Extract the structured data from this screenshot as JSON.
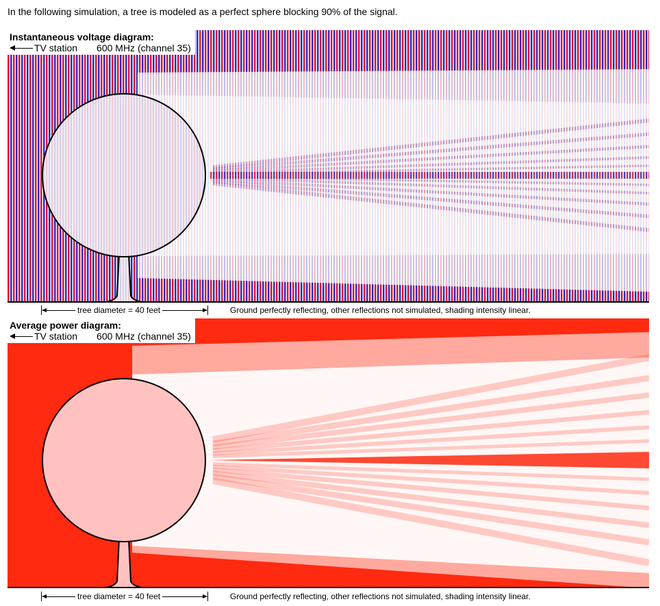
{
  "intro_text": "In the following simulation, a tree is modeled as a perfect sphere blocking 90% of the signal.",
  "diagrams": [
    {
      "title": "Instantaneous voltage diagram:",
      "direction_label": "TV station",
      "frequency_label": "600 MHz (channel 35)",
      "dimension_label": "tree diameter = 40 feet",
      "caption": "Ground perfectly reflecting, other reflections not simulated, shading intensity linear."
    },
    {
      "title": "Average power diagram:",
      "direction_label": "TV station",
      "frequency_label": "600 MHz (channel 35)",
      "dimension_label": "tree diameter = 40 feet",
      "caption": "Ground perfectly reflecting, other reflections not simulated, shading intensity linear."
    }
  ],
  "colors": {
    "voltage_positive": "#e0112b",
    "voltage_negative": "#2c2fc4",
    "power_strong": "#ff2a10",
    "tree_fill_voltage": "#f2e4ee",
    "tree_fill_power": "#ffc2c0",
    "outline": "#000000"
  }
}
